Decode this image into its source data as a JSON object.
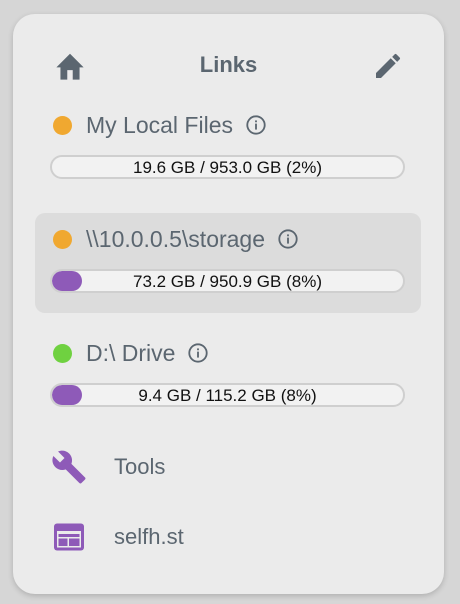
{
  "header": {
    "title": "Links",
    "home_icon": "home-icon",
    "edit_icon": "pencil-icon"
  },
  "drives": [
    {
      "name": "My Local Files",
      "status_color": "#f0a830",
      "usage_text": "19.6 GB / 953.0 GB (2%)",
      "fraction": 0.02,
      "active": false
    },
    {
      "name": "\\\\10.0.0.5\\storage",
      "status_color": "#f0a830",
      "usage_text": "73.2 GB / 950.9 GB (8%)",
      "fraction": 0.08,
      "active": true
    },
    {
      "name": "D:\\ Drive",
      "status_color": "#6fd140",
      "usage_text": "9.4 GB / 115.2 GB (8%)",
      "fraction": 0.08,
      "active": false
    }
  ],
  "links": [
    {
      "label": "Tools",
      "icon": "wrench-icon"
    },
    {
      "label": "selfh.st",
      "icon": "browser-window-icon"
    }
  ],
  "colors": {
    "accent": "#8e5ab8",
    "text": "#5b6670"
  }
}
